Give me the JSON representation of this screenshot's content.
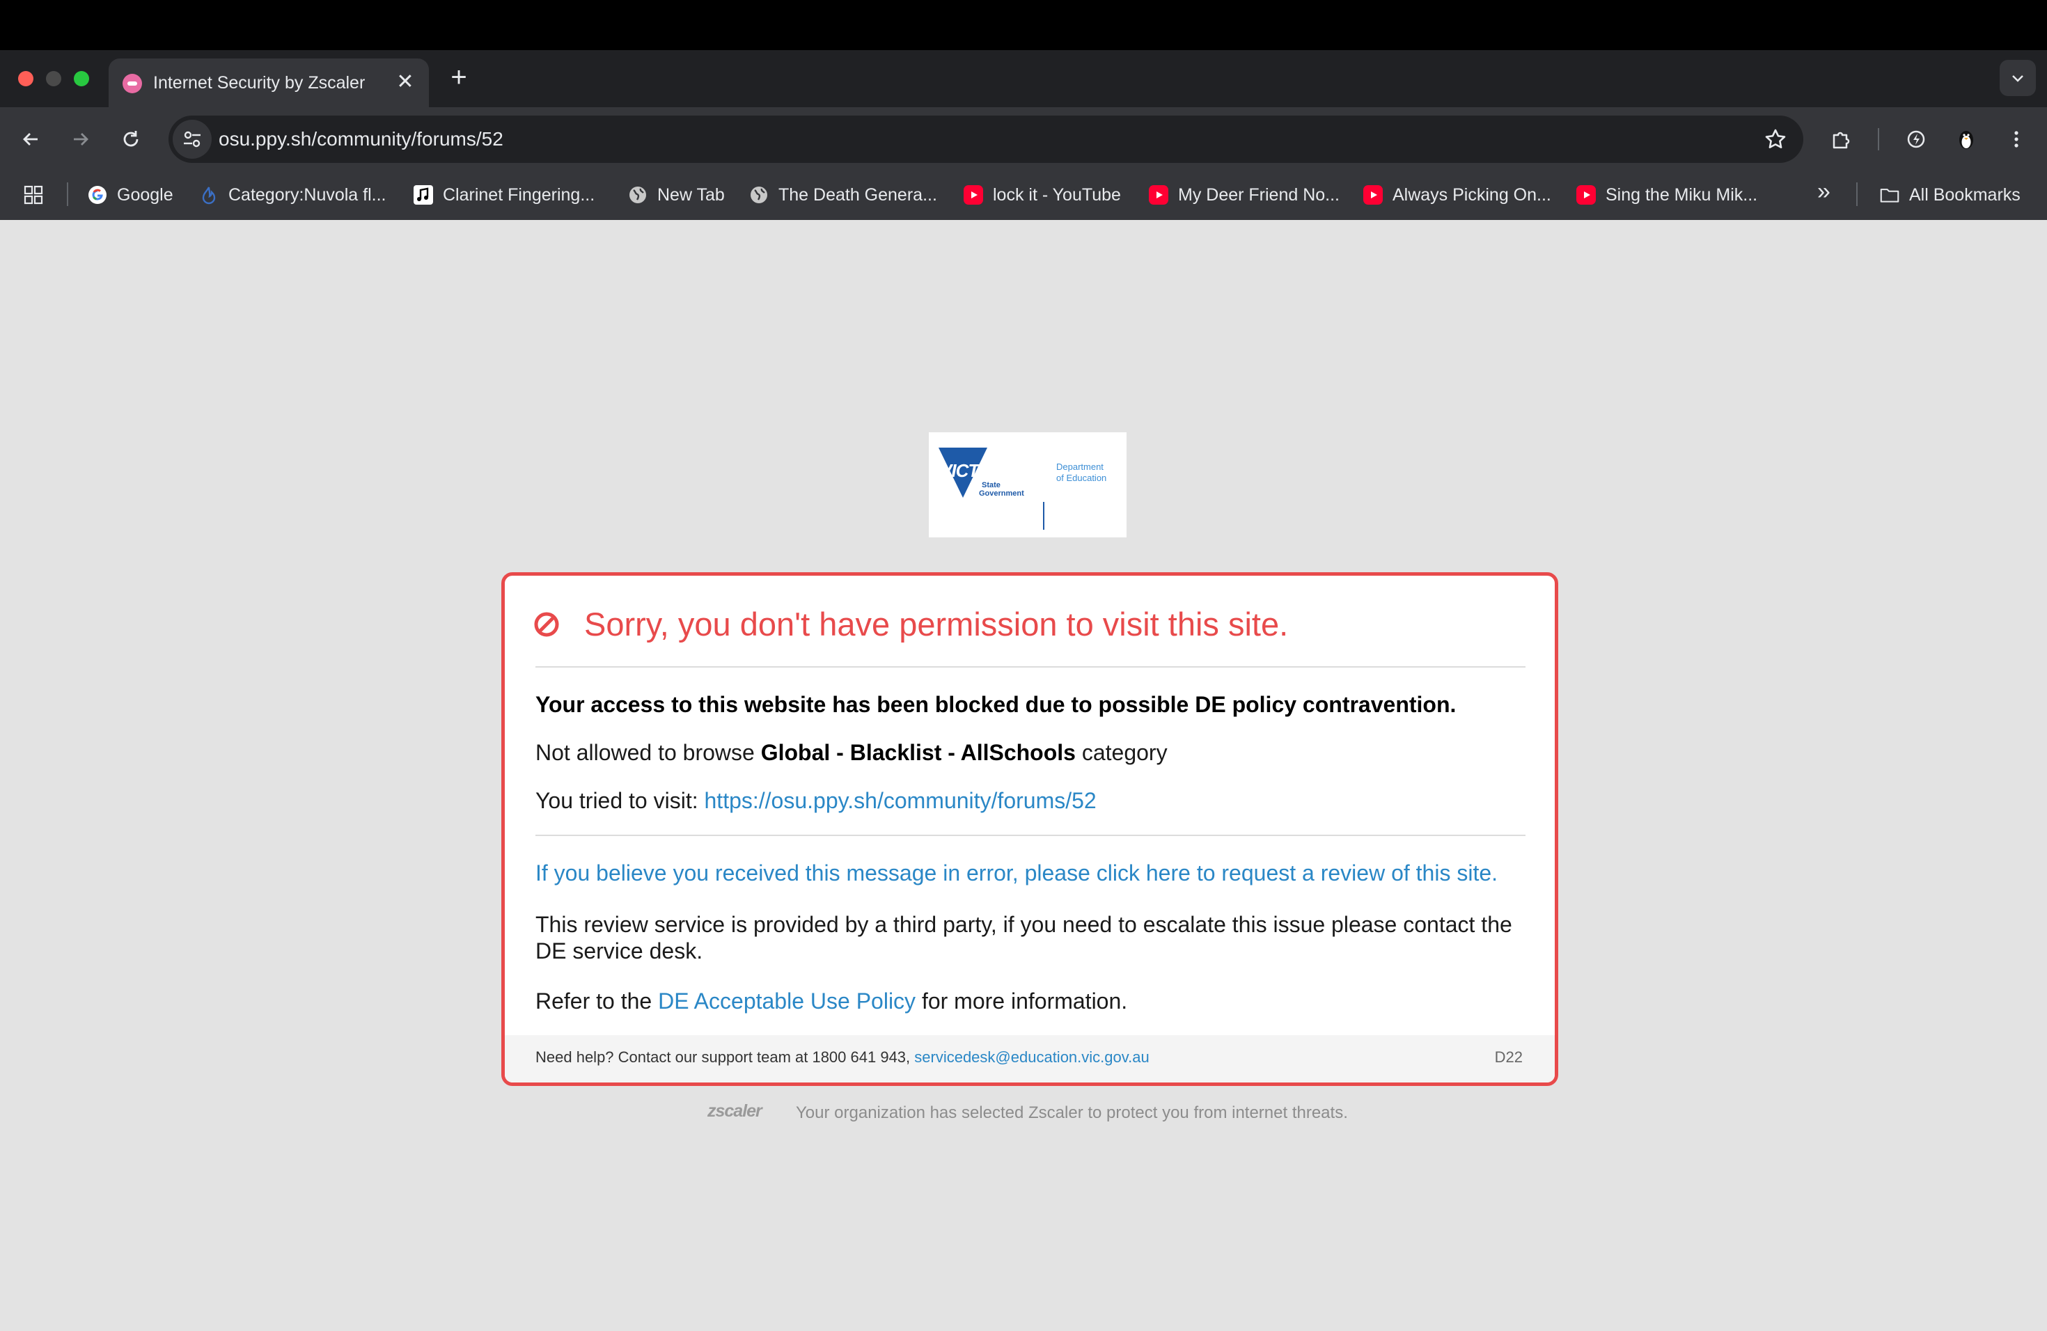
{
  "browser": {
    "tab": {
      "title": "Internet Security by Zscaler",
      "close_label": "✕"
    },
    "new_tab_label": "+",
    "url": "osu.ppy.sh/community/forums/52",
    "bookmarks": [
      {
        "label": "Google",
        "icon": "google-icon"
      },
      {
        "label": "Category:Nuvola fl...",
        "icon": "nuvola-icon"
      },
      {
        "label": "Clarinet Fingering...",
        "icon": "music-note-icon"
      },
      {
        "label": "New Tab",
        "icon": "globe-icon"
      },
      {
        "label": "The Death Genera...",
        "icon": "globe-icon"
      },
      {
        "label": "lock it - YouTube",
        "icon": "youtube-icon"
      },
      {
        "label": "My Deer Friend No...",
        "icon": "youtube-icon"
      },
      {
        "label": "Always Picking On...",
        "icon": "youtube-icon"
      },
      {
        "label": "Sing the Miku Mik...",
        "icon": "youtube-icon"
      }
    ],
    "overflow_label": "»",
    "all_bookmarks_label": "All Bookmarks"
  },
  "logo": {
    "victoria": "VICTORIA",
    "state_line1": "State",
    "state_line2": "Government",
    "dept_line1": "Department",
    "dept_line2": "of Education"
  },
  "block_page": {
    "title": "Sorry, you don't have permission to visit this site.",
    "blocked_message": "Your access to this website has been blocked due to possible DE policy contravention.",
    "category_prefix": "Not allowed to browse ",
    "category_name": "Global - Blacklist - AllSchools",
    "category_suffix": " category",
    "visit_prefix": "You tried to visit: ",
    "visit_url": "https://osu.ppy.sh/community/forums/52",
    "review_link": "If you believe you received this message in error, please click here to request a review of this site.",
    "review_line1": "This review service is provided by a third party, if you need to escalate this issue please contact the",
    "review_line2": "DE service desk.",
    "aup_prefix": "Refer to the ",
    "aup_link": "DE Acceptable Use Policy",
    "aup_suffix": " for more information.",
    "help_prefix": "Need help? Contact our support team at 1800 641 943, ",
    "help_email": "servicedesk@education.vic.gov.au",
    "code": "D22"
  },
  "zscaler": {
    "logo_text": "zscaler",
    "notice": "Your organization has selected Zscaler to protect you from internet threats."
  },
  "colors": {
    "accent_red": "#e84a4b",
    "link_blue": "#2a87c6"
  }
}
